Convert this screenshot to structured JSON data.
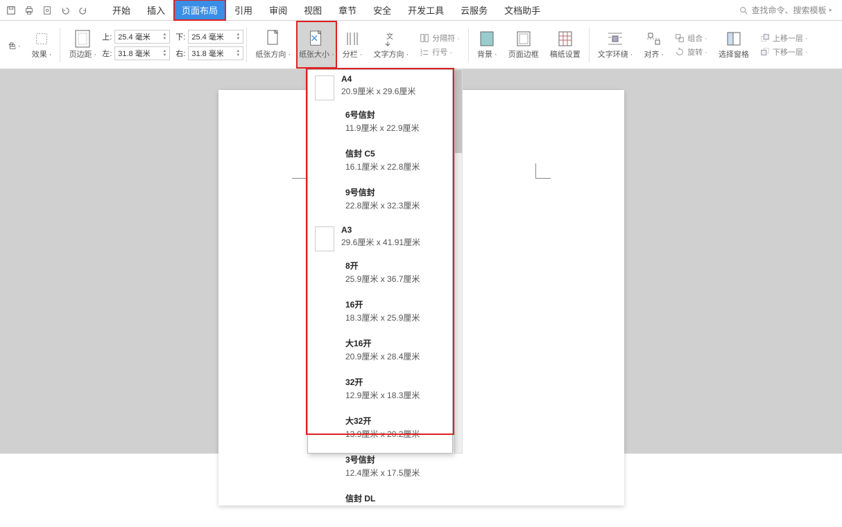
{
  "menu": {
    "start": "开始",
    "insert": "插入",
    "pagelayout": "页面布局",
    "reference": "引用",
    "review": "审阅",
    "view": "视图",
    "chapter": "章节",
    "security": "安全",
    "devtools": "开发工具",
    "cloud": "云服务",
    "dochelper": "文档助手"
  },
  "search": {
    "placeholder": "查找命令、搜索模板"
  },
  "ribbon": {
    "color": "色 ·",
    "effect": "效果 ·",
    "margin": "页边距 ·",
    "top_label": "上:",
    "bottom_label": "下:",
    "left_label": "左:",
    "right_label": "右:",
    "top": "25.4 毫米",
    "bottom": "25.4 毫米",
    "left": "31.8 毫米",
    "right": "31.8 毫米",
    "orientation": "纸张方向 ·",
    "pagesize": "纸张大小 ·",
    "columns": "分栏 ·",
    "textdir": "文字方向 ·",
    "breaks": "分隔符 ·",
    "linenum": "行号 ·",
    "background": "背景 ·",
    "border": "页面边框",
    "manuscript": "稿纸设置",
    "wrap": "文字环绕 ·",
    "align": "对齐 ·",
    "rotate": "旋转 ·",
    "group": "组合 ·",
    "selpane": "选择窗格",
    "moveup": "上移一层 ·",
    "movedown": "下移一层 ·"
  },
  "paper_sizes": [
    {
      "name": "A4",
      "dim": "20.9厘米  x  29.6厘米",
      "icon": true
    },
    {
      "name": "6号信封",
      "dim": "11.9厘米  x  22.9厘米"
    },
    {
      "name": "信封 C5",
      "dim": "16.1厘米  x  22.8厘米"
    },
    {
      "name": "9号信封",
      "dim": "22.8厘米  x  32.3厘米"
    },
    {
      "name": "A3",
      "dim": "29.6厘米  x  41.91厘米",
      "icon": true
    },
    {
      "name": "8开",
      "dim": "25.9厘米  x  36.7厘米"
    },
    {
      "name": "16开",
      "dim": "18.3厘米  x  25.9厘米"
    },
    {
      "name": "大16开",
      "dim": "20.9厘米  x  28.4厘米"
    },
    {
      "name": "32开",
      "dim": "12.9厘米  x  18.3厘米"
    },
    {
      "name": "大32开",
      "dim": "13.9厘米  x  20.2厘米"
    },
    {
      "name": "3号信封",
      "dim": "12.4厘米  x  17.5厘米"
    },
    {
      "name": "信封 DL",
      "dim": ""
    }
  ]
}
